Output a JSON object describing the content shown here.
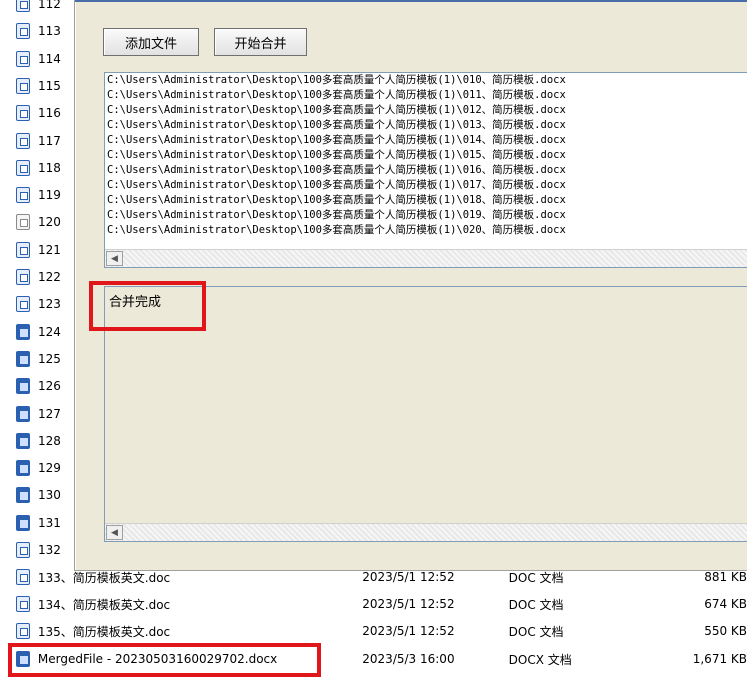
{
  "explorer": {
    "side_rows": [
      {
        "label": "112",
        "icon": "word-doc-icon",
        "variant": "light"
      },
      {
        "label": "113",
        "icon": "word-doc-icon",
        "variant": "light"
      },
      {
        "label": "114",
        "icon": "word-doc-icon",
        "variant": "light"
      },
      {
        "label": "115",
        "icon": "word-doc-icon",
        "variant": "light"
      },
      {
        "label": "116",
        "icon": "word-doc-icon",
        "variant": "light"
      },
      {
        "label": "117",
        "icon": "word-doc-icon",
        "variant": "light"
      },
      {
        "label": "118",
        "icon": "word-doc-icon",
        "variant": "light"
      },
      {
        "label": "119",
        "icon": "word-doc-icon",
        "variant": "light"
      },
      {
        "label": "120",
        "icon": "text-file-icon",
        "variant": "plain"
      },
      {
        "label": "121",
        "icon": "word-doc-icon",
        "variant": "light"
      },
      {
        "label": "122",
        "icon": "word-doc-icon",
        "variant": "light"
      },
      {
        "label": "123",
        "icon": "word-doc-icon",
        "variant": "light"
      },
      {
        "label": "124",
        "icon": "word-doc-icon",
        "variant": "dark"
      },
      {
        "label": "125",
        "icon": "word-doc-icon",
        "variant": "dark"
      },
      {
        "label": "126",
        "icon": "word-doc-icon",
        "variant": "dark"
      },
      {
        "label": "127",
        "icon": "word-doc-icon",
        "variant": "dark"
      },
      {
        "label": "128",
        "icon": "word-doc-icon",
        "variant": "dark"
      },
      {
        "label": "129",
        "icon": "word-doc-icon",
        "variant": "dark"
      },
      {
        "label": "130",
        "icon": "word-doc-icon",
        "variant": "dark"
      },
      {
        "label": "131",
        "icon": "word-doc-icon",
        "variant": "dark"
      },
      {
        "label": "132",
        "icon": "word-doc-icon",
        "variant": "light"
      }
    ],
    "files": [
      {
        "name": "133、简历模板英文.doc",
        "date": "2023/5/1 12:52",
        "type": "DOC 文档",
        "size": "881 KB",
        "variant": "light"
      },
      {
        "name": "134、简历模板英文.doc",
        "date": "2023/5/1 12:52",
        "type": "DOC 文档",
        "size": "674 KB",
        "variant": "light"
      },
      {
        "name": "135、简历模板英文.doc",
        "date": "2023/5/1 12:52",
        "type": "DOC 文档",
        "size": "550 KB",
        "variant": "light"
      },
      {
        "name": "MergedFile - 20230503160029702.docx",
        "date": "2023/5/3 16:00",
        "type": "DOCX 文档",
        "size": "1,671 KB",
        "variant": "dark"
      }
    ]
  },
  "dialog": {
    "add_button": "添加文件",
    "merge_button": "开始合并",
    "paths": [
      "C:\\Users\\Administrator\\Desktop\\100多套高质量个人简历模板(1)\\010、简历模板.docx",
      "C:\\Users\\Administrator\\Desktop\\100多套高质量个人简历模板(1)\\011、简历模板.docx",
      "C:\\Users\\Administrator\\Desktop\\100多套高质量个人简历模板(1)\\012、简历模板.docx",
      "C:\\Users\\Administrator\\Desktop\\100多套高质量个人简历模板(1)\\013、简历模板.docx",
      "C:\\Users\\Administrator\\Desktop\\100多套高质量个人简历模板(1)\\014、简历模板.docx",
      "C:\\Users\\Administrator\\Desktop\\100多套高质量个人简历模板(1)\\015、简历模板.docx",
      "C:\\Users\\Administrator\\Desktop\\100多套高质量个人简历模板(1)\\016、简历模板.docx",
      "C:\\Users\\Administrator\\Desktop\\100多套高质量个人简历模板(1)\\017、简历模板.docx",
      "C:\\Users\\Administrator\\Desktop\\100多套高质量个人简历模板(1)\\018、简历模板.docx",
      "C:\\Users\\Administrator\\Desktop\\100多套高质量个人简历模板(1)\\019、简历模板.docx",
      "C:\\Users\\Administrator\\Desktop\\100多套高质量个人简历模板(1)\\020、简历模板.docx"
    ],
    "status": "合并完成",
    "scroll_arrow": "◀"
  },
  "colors": {
    "highlight": "#e0161b",
    "dialog_bg": "#ece9d8",
    "word_blue": "#2b5fb0"
  }
}
